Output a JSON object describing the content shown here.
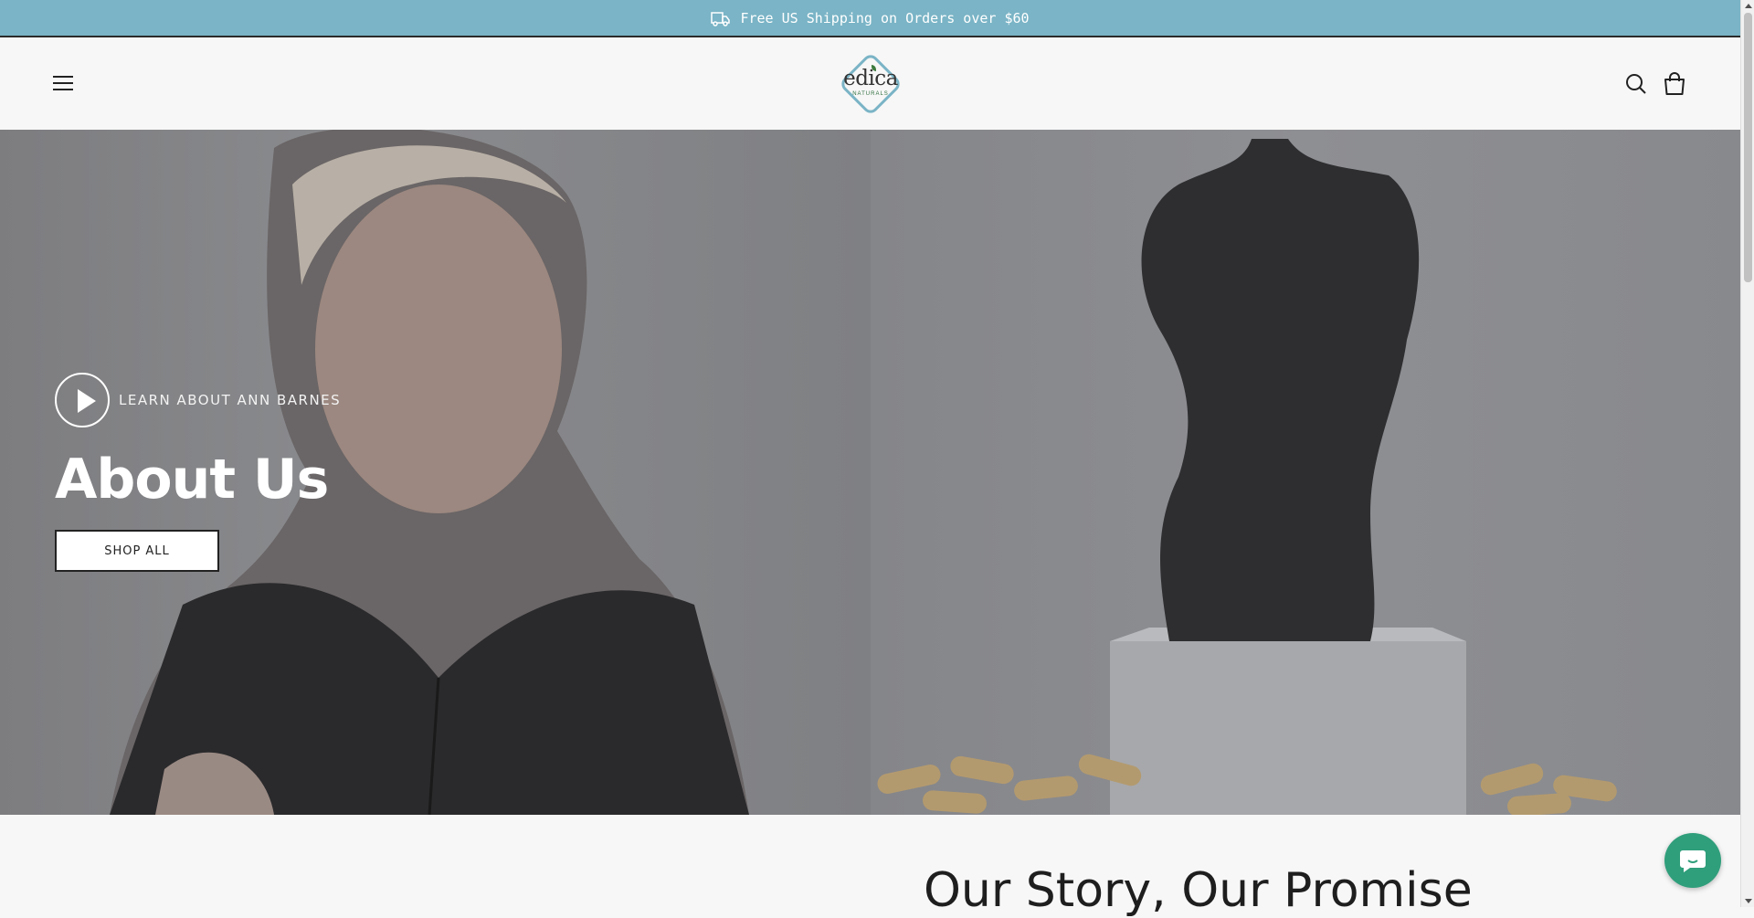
{
  "announcement": {
    "text": "Free US Shipping on Orders over $60",
    "icon": "delivery-truck-icon"
  },
  "header": {
    "menu_icon": "hamburger-menu-icon",
    "logo": {
      "word": "edica",
      "sub": "NATURALS"
    },
    "search_icon": "search-icon",
    "cart_icon": "shopping-bag-icon"
  },
  "hero": {
    "video_link_label": "LEARN ABOUT ANN BARNES",
    "title": "About Us",
    "button_label": "SHOP ALL"
  },
  "story": {
    "heading": "Our Story, Our Promise"
  },
  "chat": {
    "icon": "chat-bubble-icon"
  },
  "colors": {
    "announcement_bg": "#7ab4c6",
    "header_bg": "#f7f7f7",
    "chat_bg": "#2f9e7b"
  }
}
